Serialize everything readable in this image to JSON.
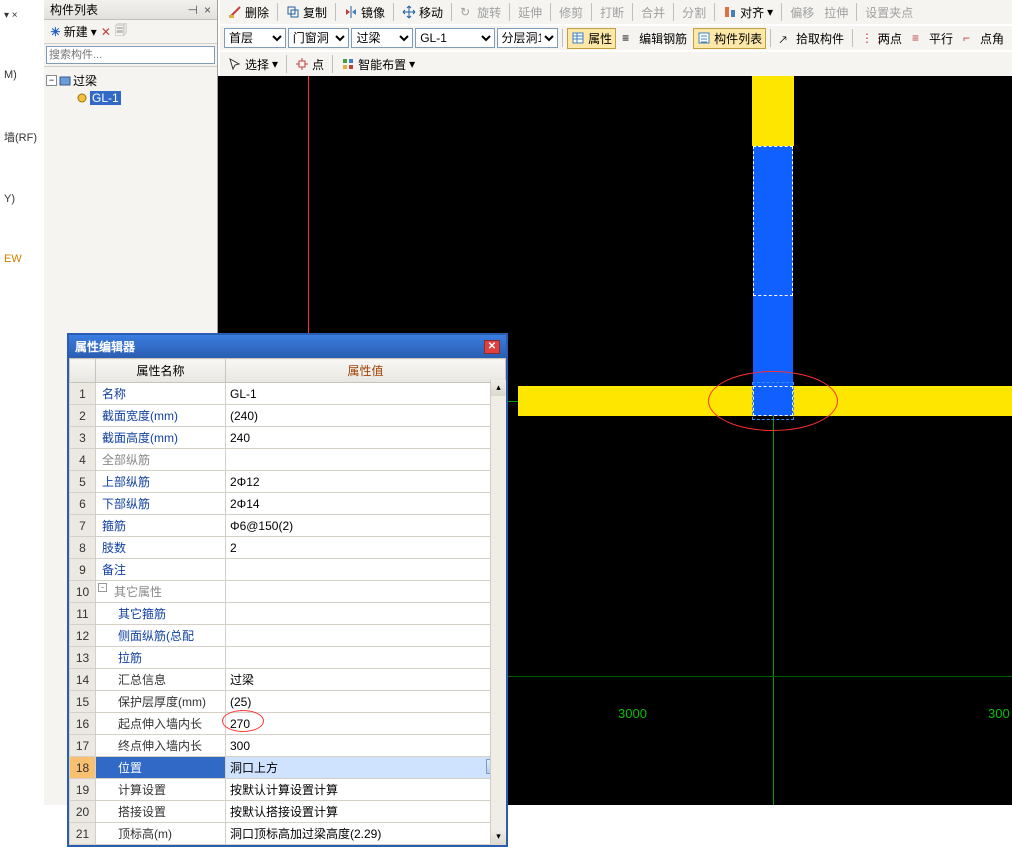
{
  "toolbar1": {
    "delete": "删除",
    "copy": "复制",
    "mirror": "镜像",
    "move": "移动",
    "rotate": "旋转",
    "extend": "延伸",
    "trim": "修剪",
    "break": "打断",
    "merge": "合并",
    "split": "分割",
    "align": "对齐",
    "offset": "偏移",
    "stretch": "拉伸",
    "grip": "设置夹点"
  },
  "toolbar2": {
    "floor": "首层",
    "subcat": "门窗洞",
    "type": "过梁",
    "member": "GL-1",
    "layer": "分层洞1",
    "props": "属性",
    "editrebar": "编辑钢筋",
    "memberlist": "构件列表",
    "pick": "拾取构件",
    "twopoint": "两点",
    "parallel": "平行",
    "corner": "点角"
  },
  "toolbar3": {
    "select": "选择",
    "point": "点",
    "smart": "智能布置"
  },
  "panel": {
    "title": "构件列表",
    "new": "新建",
    "search_placeholder": "搜索构件...",
    "root": "过梁",
    "child": "GL-1"
  },
  "left": {
    "m": "M)",
    "rf": "墙(RF)",
    "y": "Y)",
    "ew": "EW"
  },
  "canvas": {
    "dim": "3000",
    "dim2": "300"
  },
  "dialog": {
    "title": "属性编辑器",
    "col_name": "属性名称",
    "col_value": "属性值",
    "rows": [
      {
        "n": "1",
        "name": "名称",
        "name_cls": "blue",
        "val": "GL-1"
      },
      {
        "n": "2",
        "name": "截面宽度(mm)",
        "name_cls": "blue",
        "val": "(240)"
      },
      {
        "n": "3",
        "name": "截面高度(mm)",
        "name_cls": "blue",
        "val": "240"
      },
      {
        "n": "4",
        "name": "全部纵筋",
        "name_cls": "gray",
        "val": ""
      },
      {
        "n": "5",
        "name": "上部纵筋",
        "name_cls": "blue",
        "val": "2Φ12"
      },
      {
        "n": "6",
        "name": "下部纵筋",
        "name_cls": "blue",
        "val": "2Φ14"
      },
      {
        "n": "7",
        "name": "箍筋",
        "name_cls": "blue",
        "val": "Φ6@150(2)"
      },
      {
        "n": "8",
        "name": "肢数",
        "name_cls": "blue",
        "val": "2"
      },
      {
        "n": "9",
        "name": "备注",
        "name_cls": "blue",
        "val": ""
      },
      {
        "n": "10",
        "name": "其它属性",
        "name_cls": "gray",
        "val": "",
        "collapse": "-"
      },
      {
        "n": "11",
        "name": "其它箍筋",
        "name_cls": "blue",
        "val": "",
        "indent": true
      },
      {
        "n": "12",
        "name": "侧面纵筋(总配",
        "name_cls": "blue",
        "val": "",
        "indent": true
      },
      {
        "n": "13",
        "name": "拉筋",
        "name_cls": "blue",
        "val": "",
        "indent": true
      },
      {
        "n": "14",
        "name": "汇总信息",
        "name_cls": "black",
        "val": "过梁",
        "indent": true
      },
      {
        "n": "15",
        "name": "保护层厚度(mm)",
        "name_cls": "black",
        "val": "(25)",
        "indent": true
      },
      {
        "n": "16",
        "name": "起点伸入墙内长",
        "name_cls": "black",
        "val": "270",
        "indent": true,
        "mark": true
      },
      {
        "n": "17",
        "name": "终点伸入墙内长",
        "name_cls": "black",
        "val": "300",
        "indent": true
      },
      {
        "n": "18",
        "name": "位置",
        "name_cls": "black",
        "val": "洞口上方",
        "indent": true,
        "sel": true,
        "combo": true
      },
      {
        "n": "19",
        "name": "计算设置",
        "name_cls": "black",
        "val": "按默认计算设置计算",
        "indent": true
      },
      {
        "n": "20",
        "name": "搭接设置",
        "name_cls": "black",
        "val": "按默认搭接设置计算",
        "indent": true
      },
      {
        "n": "21",
        "name": "顶标高(m)",
        "name_cls": "black",
        "val": "洞口顶标高加过梁高度(2.29)",
        "indent": true
      }
    ]
  }
}
